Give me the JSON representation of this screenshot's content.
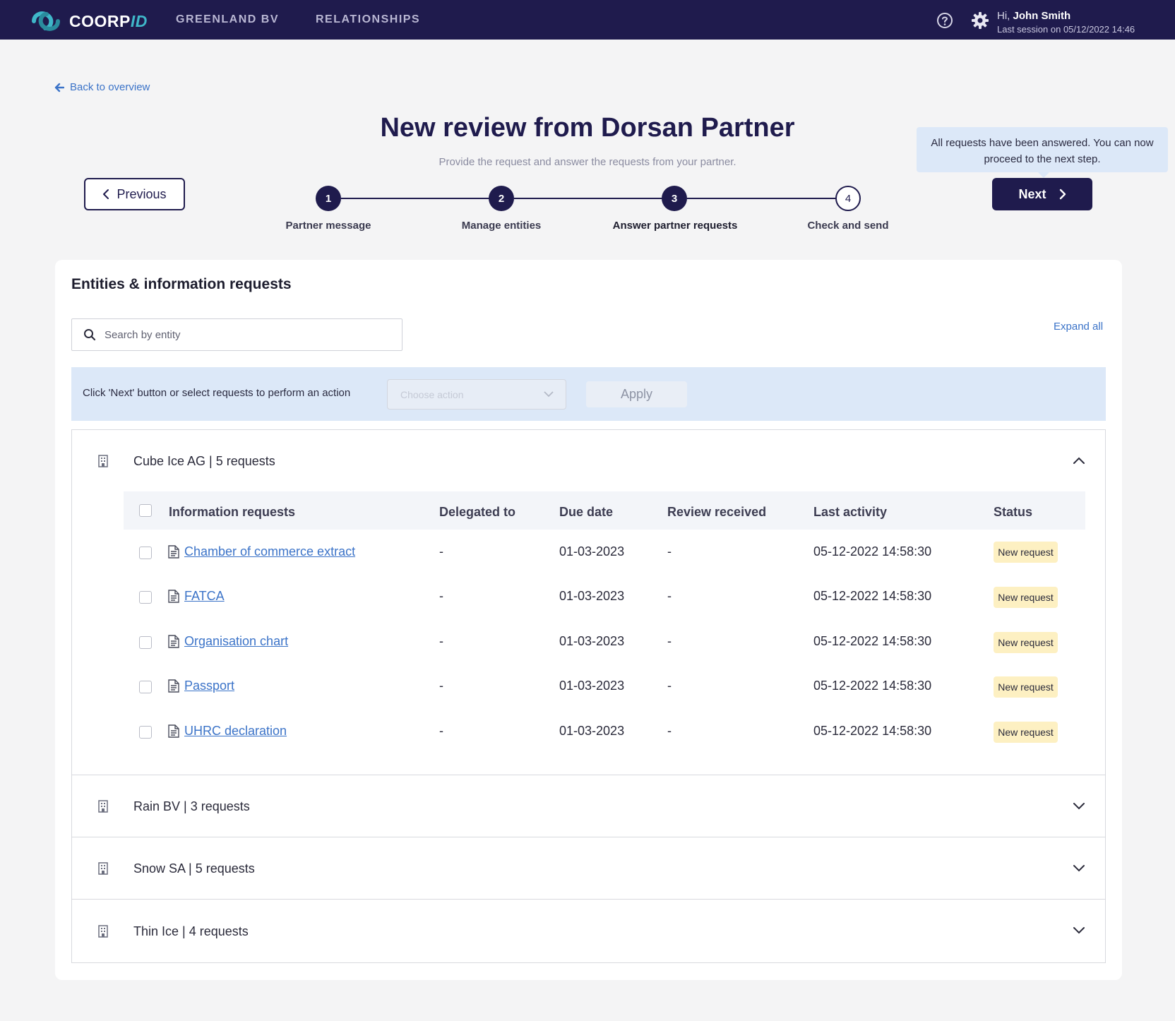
{
  "header": {
    "logo_main": "COORP",
    "logo_accent": "ID",
    "nav": [
      "GREENLAND BV",
      "RELATIONSHIPS"
    ],
    "user_greeting_prefix": "Hi, ",
    "user_name": "John Smith",
    "last_session": "Last session on  05/12/2022 14:46"
  },
  "back_link": "Back to overview",
  "title": "New review from Dorsan Partner",
  "subtitle": "Provide the request and answer the requests from your partner.",
  "buttons": {
    "previous": "Previous",
    "next": "Next"
  },
  "tooltip": "All requests have been answered. You can now proceed to the next step.",
  "steps": [
    {
      "number": "1",
      "label": "Partner message",
      "state": "done"
    },
    {
      "number": "2",
      "label": "Manage entities",
      "state": "done"
    },
    {
      "number": "3",
      "label": "Answer partner requests",
      "state": "active"
    },
    {
      "number": "4",
      "label": "Check and send",
      "state": "todo"
    }
  ],
  "card": {
    "title": "Entities & information requests",
    "search_placeholder": "Search by entity",
    "expand_all": "Expand all",
    "action_text": "Click 'Next' button or select requests to perform an action",
    "action_placeholder": "Choose action",
    "apply": "Apply"
  },
  "table_headers": [
    "Information requests",
    "Delegated to",
    "Due date",
    "Review received",
    "Last activity",
    "Status"
  ],
  "entities": [
    {
      "name": "Cube Ice AG | 5 requests",
      "expanded": true,
      "requests": [
        {
          "name": "Chamber of commerce extract",
          "delegated": "-",
          "due": "01-03-2023",
          "review": "-",
          "last_activity": "05-12-2022 14:58:30",
          "status": "New request"
        },
        {
          "name": "FATCA",
          "delegated": "-",
          "due": "01-03-2023",
          "review": "-",
          "last_activity": "05-12-2022 14:58:30",
          "status": "New request"
        },
        {
          "name": "Organisation chart",
          "delegated": "-",
          "due": "01-03-2023",
          "review": "-",
          "last_activity": "05-12-2022 14:58:30",
          "status": "New request"
        },
        {
          "name": "Passport",
          "delegated": "-",
          "due": "01-03-2023",
          "review": "-",
          "last_activity": "05-12-2022 14:58:30",
          "status": "New request"
        },
        {
          "name": "UHRC declaration",
          "delegated": "-",
          "due": "01-03-2023",
          "review": "-",
          "last_activity": "05-12-2022 14:58:30",
          "status": "New request"
        }
      ]
    },
    {
      "name": "Rain BV | 3 requests",
      "expanded": false
    },
    {
      "name": "Snow SA | 5 requests",
      "expanded": false
    },
    {
      "name": "Thin Ice | 4 requests",
      "expanded": false
    }
  ],
  "colors": {
    "navy": "#1f1b4d",
    "link": "#3b73c8",
    "badge_bg": "#fdf0c2",
    "action_bar": "#dce8f8"
  }
}
